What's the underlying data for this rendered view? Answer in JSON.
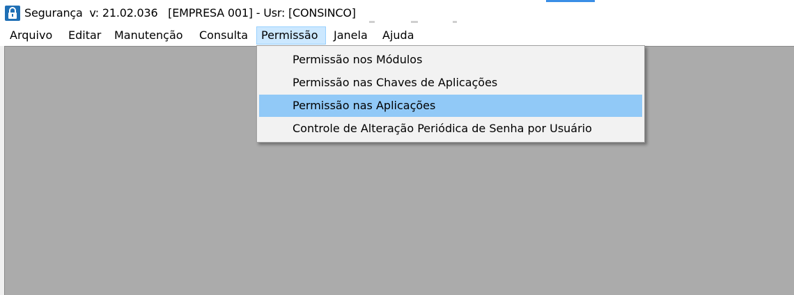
{
  "window": {
    "title": "Segurança  v: 21.02.036   [EMPRESA 001] - Usr: [CONSINCO]",
    "icon": "lock-icon"
  },
  "menubar": {
    "items": [
      {
        "label": "Arquivo"
      },
      {
        "label": "Editar"
      },
      {
        "label": "Manutenção"
      },
      {
        "label": "Consulta"
      },
      {
        "label": "Permissão",
        "active": true
      },
      {
        "label": "Janela"
      },
      {
        "label": "Ajuda"
      }
    ]
  },
  "dropdown": {
    "items": [
      {
        "label": "Permissão nos Módulos"
      },
      {
        "label": "Permissão nas Chaves de Aplicações"
      },
      {
        "label": "Permissão nas Aplicações",
        "highlighted": true
      },
      {
        "label": "Controle de Alteração Periódica de Senha por Usuário"
      }
    ]
  },
  "colors": {
    "client_background": "#ababab",
    "menu_active": "#cce8ff",
    "dropdown_highlight": "#91c9f7",
    "icon_blue": "#1f6fb5"
  }
}
